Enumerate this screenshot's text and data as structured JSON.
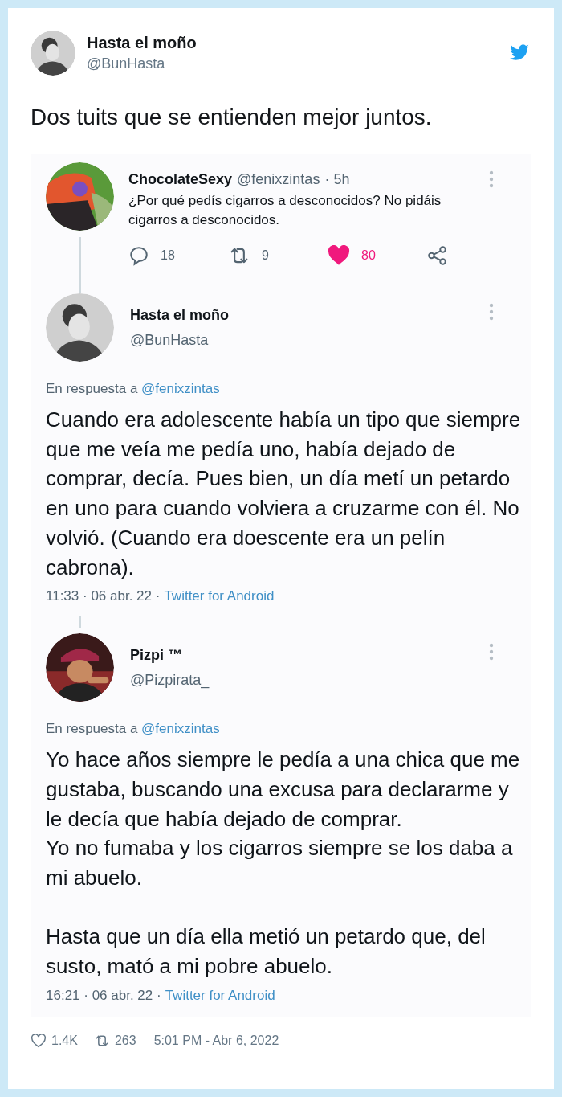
{
  "author": {
    "name": "Hasta el moño",
    "handle": "@BunHasta"
  },
  "text": "Dos tuits que se entienden mejor juntos.",
  "screenshot": [
    {
      "kind": "compact",
      "name": "ChocolateSexy",
      "handle": "@fenixzintas",
      "time": "· 5h",
      "text": "¿Por qué pedís cigarros a desconocidos? No pidáis cigarros a desconocidos.",
      "replies": "18",
      "retweets": "9",
      "likes": "80",
      "liked": true
    },
    {
      "kind": "expanded",
      "name": "Hasta el moño",
      "handle": "@BunHasta",
      "reply_prefix": "En respuesta a",
      "reply_to": "@fenixzintas",
      "text": "Cuando era adolescente había un tipo que siempre que me veía me pedía uno, había dejado de comprar, decía. Pues bien, un día metí un petardo en uno para cuando volviera a cruzarme con él. No volvió. (Cuando era doescente era un pelín cabrona).",
      "date": "11:33 · 06 abr. 22 ·",
      "source": "Twitter for Android"
    },
    {
      "kind": "expanded",
      "name": "Pizpi ™",
      "handle": "@Pizpirata_",
      "reply_prefix": "En respuesta a",
      "reply_to": "@fenixzintas",
      "text": "Yo hace años siempre le pedía a una chica que me gustaba, buscando una excusa para declararme y le decía que había dejado de comprar.\nYo no fumaba y los cigarros siempre se los daba a mi abuelo.\n\nHasta que un día ella metió un petardo que, del susto, mató a mi pobre abuelo.",
      "date": "16:21 · 06 abr. 22 ·",
      "source": "Twitter for Android"
    }
  ],
  "footer": {
    "likes": "1.4K",
    "retweets": "263",
    "timestamp": "5:01 PM - Abr 6, 2022"
  }
}
